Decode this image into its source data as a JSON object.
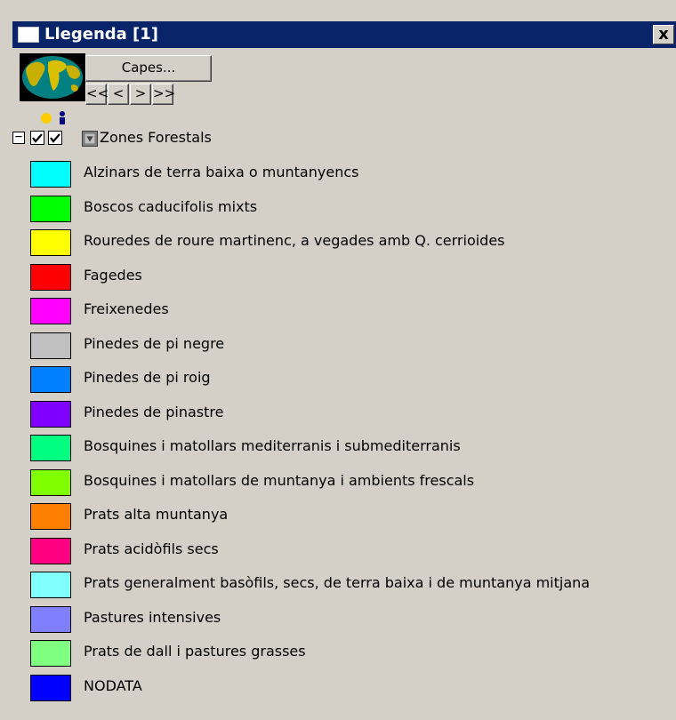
{
  "window": {
    "title": "Llegenda [1]",
    "close_label": "x"
  },
  "toolbar": {
    "capes_label": "Capes...",
    "nav": [
      "<<",
      "<",
      ">",
      ">>"
    ]
  },
  "layer": {
    "expander": "−",
    "visible_checked": true,
    "queryable_checked": true,
    "name": "Zones Forestals"
  },
  "legend": {
    "items": [
      {
        "label": "Alzinars de terra baixa o muntanyencs",
        "color": "#00ffff"
      },
      {
        "label": "Boscos caducifolis mixts",
        "color": "#00ff00"
      },
      {
        "label": "Rouredes de roure martinenc, a vegades amb Q. cerrioides",
        "color": "#ffff00"
      },
      {
        "label": "Fagedes",
        "color": "#ff0000"
      },
      {
        "label": "Freixenedes",
        "color": "#ff00ff"
      },
      {
        "label": "Pinedes de pi negre",
        "color": "#c0c0c0"
      },
      {
        "label": "Pinedes de pi roig",
        "color": "#0080ff"
      },
      {
        "label": "Pinedes de pinastre",
        "color": "#8000ff"
      },
      {
        "label": "Bosquines i matollars mediterranis i submediterranis",
        "color": "#00ff80"
      },
      {
        "label": "Bosquines i matollars de muntanya i ambients frescals",
        "color": "#80ff00"
      },
      {
        "label": "Prats alta muntanya",
        "color": "#ff8000"
      },
      {
        "label": "Prats acidòfils secs",
        "color": "#ff0080"
      },
      {
        "label": "Prats generalment basòfils, secs, de terra baixa i de muntanya mitjana",
        "color": "#80ffff"
      },
      {
        "label": "Pastures intensives",
        "color": "#8080ff"
      },
      {
        "label": "Prats de dall i pastures grasses",
        "color": "#80ff80"
      },
      {
        "label": "NODATA",
        "color": "#0000ff"
      }
    ]
  },
  "colors": {
    "titlebar": "#0a246a",
    "panel": "#d4d0c8"
  }
}
